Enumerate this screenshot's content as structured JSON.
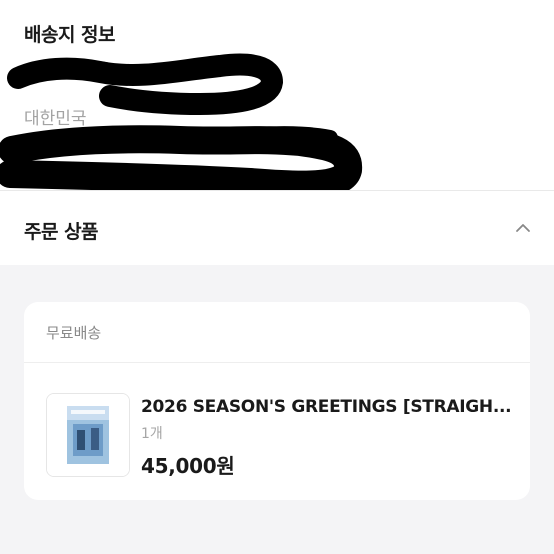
{
  "shipping": {
    "title": "배송지 정보",
    "country": "대한민국"
  },
  "order": {
    "title": "주문 상품",
    "collapse_icon": "chevron-up-icon"
  },
  "card": {
    "shipping_label": "무료배송",
    "product": {
      "name": "2026 SEASON'S GREETINGS [STRAIGH...",
      "quantity": "1개",
      "price": "45,000원"
    }
  },
  "colors": {
    "background_gray": "#f4f4f6",
    "text_primary": "#1a1a1a",
    "text_secondary": "#a3a3a3",
    "redaction": "#000000"
  }
}
